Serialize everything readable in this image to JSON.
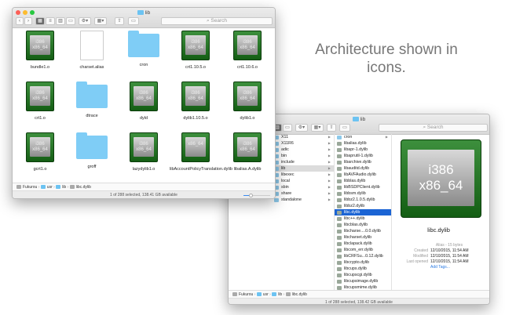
{
  "caption": "Architecture shown in icons.",
  "window1": {
    "title": "lib",
    "search_placeholder": "Search",
    "items": [
      {
        "name": "bundle1.o",
        "type": "chip",
        "arch": [
          "i386",
          "x86_64"
        ]
      },
      {
        "name": "charset.alias",
        "type": "doc"
      },
      {
        "name": "cron",
        "type": "folder"
      },
      {
        "name": "crt1.10.5.o",
        "type": "chip",
        "arch": [
          "i386",
          "x86_64"
        ]
      },
      {
        "name": "crt1.10.6.o",
        "type": "chip",
        "arch": [
          "i386",
          "x86_64"
        ]
      },
      {
        "name": "crt1.o",
        "type": "chip",
        "arch": [
          "i386",
          "x86_64"
        ]
      },
      {
        "name": "dtrace",
        "type": "folder"
      },
      {
        "name": "dyld",
        "type": "chip",
        "arch": [
          "i386",
          "x86_64"
        ]
      },
      {
        "name": "dylib1.10.5.o",
        "type": "chip",
        "arch": [
          "i386",
          "x86_64"
        ]
      },
      {
        "name": "dylib1.o",
        "type": "chip",
        "arch": [
          "i386",
          "x86_64"
        ]
      },
      {
        "name": "gcrt1.o",
        "type": "chip",
        "arch": [
          "i386",
          "x86_64"
        ]
      },
      {
        "name": "groff",
        "type": "folder"
      },
      {
        "name": "lazydylib1.o",
        "type": "chip",
        "arch": [
          "i386",
          "x86_64"
        ]
      },
      {
        "name": "libAccountPolicyTranslation.dylib",
        "type": "chip",
        "arch": [
          "",
          "x86_64"
        ]
      },
      {
        "name": "libalias.A.dylib",
        "type": "chip",
        "arch": [
          "i386",
          "x86_64"
        ]
      }
    ],
    "path": [
      "Fukurou",
      "usr",
      "lib",
      "libc.dylib"
    ],
    "status": "1 of 288 selected, 138.41 GB available",
    "icon_size_slider": 0.3
  },
  "window2": {
    "title": "lib",
    "search_placeholder": "Search",
    "col1": [
      "X11",
      "X11R6",
      "adic",
      "bin",
      "include",
      "lib",
      "libexec",
      "local",
      "sbin",
      "share",
      "standalone"
    ],
    "col2": [
      "cron",
      "libalias.dylib",
      "libapr-1.dylib",
      "libaprutil-1.dylib",
      "libarchive.dylib",
      "libauditd.dylib",
      "libAVFAudio.dylib",
      "libblas.dylib",
      "libBSDPClient.dylib",
      "libbsm.dylib",
      "libbz2.1.0.5.dylib",
      "libbz2.dylib",
      "libc.dylib",
      "libc++.dylib",
      "libcblas.dylib",
      "libcharse....0.0.dylib",
      "libcharset.dylib",
      "libclapack.dylib",
      "libcom_err.dylib",
      "libCRFSu...0.12.dylib",
      "libcrypto.dylib",
      "libcups.dylib",
      "libcupscgi.dylib",
      "libcupsimage.dylib",
      "libcupsmime.dylib"
    ],
    "preview": {
      "arch": [
        "i386",
        "x86_64"
      ],
      "name": "libc.dylib",
      "kind": "Alias - 15 bytes",
      "created_label": "Created",
      "created": "12/10/2015, 11:54 AM",
      "modified_label": "Modified",
      "modified": "12/10/2015, 11:54 AM",
      "opened_label": "Last opened",
      "opened": "12/10/2015, 11:54 AM",
      "add_tags": "Add Tags..."
    },
    "path": [
      "Fukurou",
      "usr",
      "lib",
      "libc.dylib"
    ],
    "status": "1 of 288 selected, 138.42 GB available"
  },
  "colors": {
    "selection": "#1b64d4",
    "folder": "#7fcdf6",
    "chip_green": "#2a7a2a",
    "link": "#2a7ae2"
  }
}
